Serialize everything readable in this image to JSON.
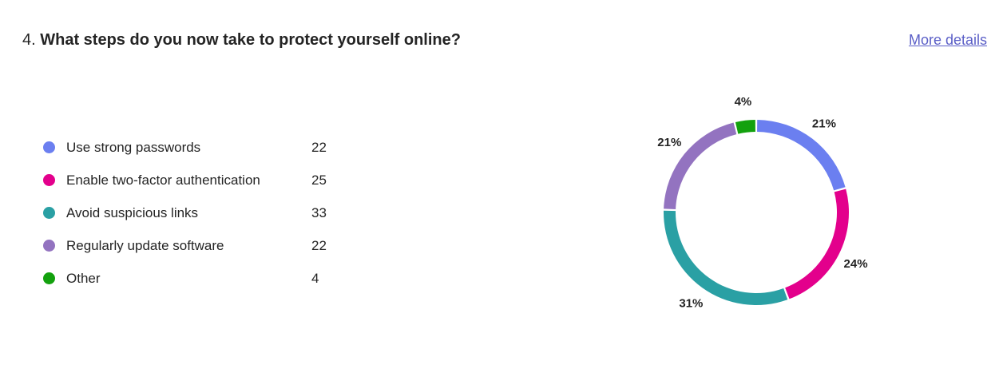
{
  "question": {
    "number": "4.",
    "text": "What steps do you now take to protect yourself online?"
  },
  "more_details_label": "More details",
  "chart_data": {
    "type": "pie",
    "donut": true,
    "categories": [
      "Use strong passwords",
      "Enable two-factor authentication",
      "Avoid suspicious links",
      "Regularly update software",
      "Other"
    ],
    "values": [
      22,
      25,
      33,
      22,
      4
    ],
    "percent_labels": [
      "21%",
      "24%",
      "31%",
      "21%",
      "4%"
    ],
    "colors": [
      "#6b7ff0",
      "#e3008c",
      "#2aa0a4",
      "#9373c0",
      "#13a10e"
    ],
    "legend_position": "left"
  }
}
